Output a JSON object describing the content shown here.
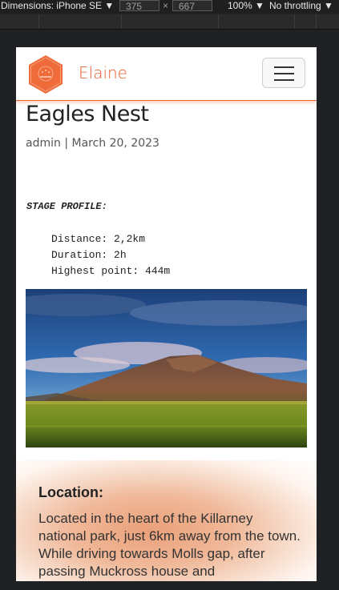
{
  "devtools": {
    "dimensions_label": "Dimensions: iPhone SE ▼",
    "width": "375",
    "times": "×",
    "height": "667",
    "zoom": "100% ▼",
    "throttling": "No throttling ▼"
  },
  "navbar": {
    "brand": "Elaine",
    "logo_icon": "hexagon-logo-icon",
    "menu_icon": "hamburger-menu-icon",
    "accent_color": "#ea5b2d"
  },
  "post": {
    "title": "Eagles Nest",
    "meta": "admin | March 20, 2023",
    "stage_heading": "STAGE PROFILE:",
    "stats": [
      "Distance: 2,2km",
      "Duration: 2h",
      "Highest point: 444m"
    ]
  },
  "location": {
    "title": "Location:",
    "text": "Located in the heart of the Killarney national park, just 6km away from the town. While driving towards Molls gap, after passing Muckross house and"
  }
}
